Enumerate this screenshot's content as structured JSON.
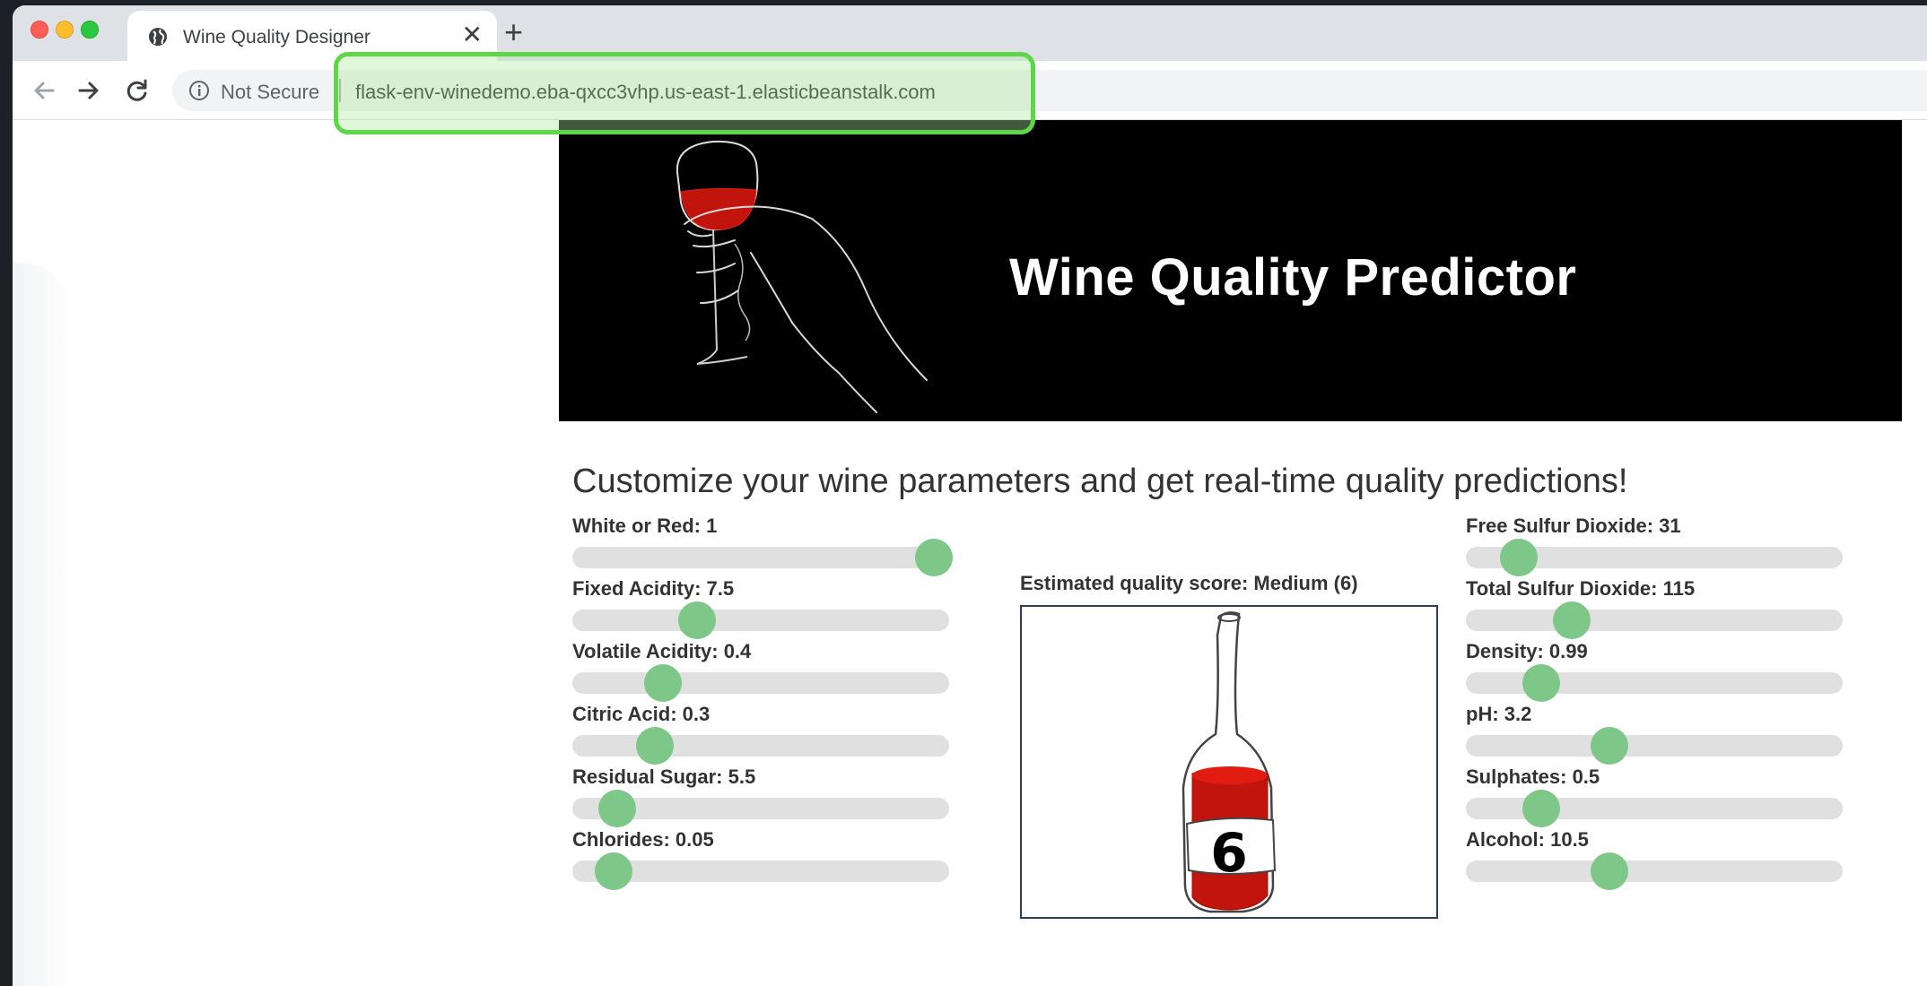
{
  "browser": {
    "tab_title": "Wine Quality Designer",
    "tab_close": "✕",
    "new_tab": "+",
    "security_label": "Not Secure",
    "url": "flask-env-winedemo.eba-qxcc3vhp.us-east-1.elasticbeanstalk.com",
    "highlight_color": "#5fd54a"
  },
  "page": {
    "title": "Wine Quality Predictor",
    "subtitle": "Customize your wine parameters and get real-time quality predictions!",
    "estimate_label": "Estimated quality score: Medium (6)",
    "bottle_score": "6"
  },
  "sliders_left": [
    {
      "label": "White or Red: 1",
      "fraction": 0.96
    },
    {
      "label": "Fixed Acidity: 7.5",
      "fraction": 0.33
    },
    {
      "label": "Volatile Acidity: 0.4",
      "fraction": 0.24
    },
    {
      "label": "Citric Acid: 0.3",
      "fraction": 0.22
    },
    {
      "label": "Residual Sugar: 5.5",
      "fraction": 0.12
    },
    {
      "label": "Chlorides: 0.05",
      "fraction": 0.11
    }
  ],
  "sliders_right": [
    {
      "label": "Free Sulfur Dioxide: 31",
      "fraction": 0.14
    },
    {
      "label": "Total Sulfur Dioxide: 115",
      "fraction": 0.28
    },
    {
      "label": "Density: 0.99",
      "fraction": 0.2
    },
    {
      "label": "pH: 3.2",
      "fraction": 0.38
    },
    {
      "label": "Sulphates: 0.5",
      "fraction": 0.2
    },
    {
      "label": "Alcohol: 10.5",
      "fraction": 0.38
    }
  ],
  "colors": {
    "thumb": "#7dc789",
    "track": "#e0e0e0",
    "wine": "#c0140c"
  }
}
